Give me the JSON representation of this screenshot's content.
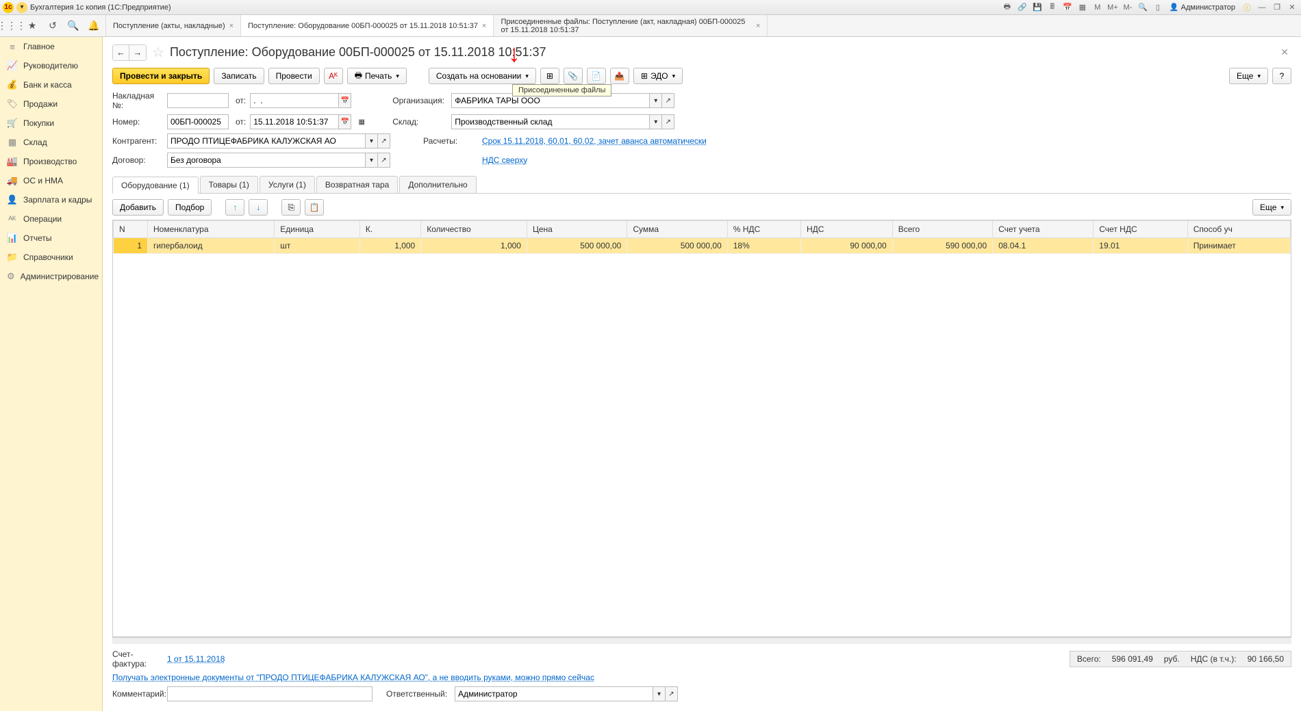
{
  "titlebar": {
    "app_title": "Бухгалтерия 1с копия  (1С:Предприятие)",
    "user": "Администратор",
    "m_labels": [
      "M",
      "M+",
      "M-"
    ]
  },
  "doc_tabs": [
    {
      "label": "Поступление (акты, накладные)",
      "active": false
    },
    {
      "label": "Поступление: Оборудование 00БП-000025 от 15.11.2018 10:51:37",
      "active": true
    },
    {
      "label": "Присоединенные файлы: Поступление (акт, накладная) 00БП-000025 от 15.11.2018 10:51:37",
      "active": false
    }
  ],
  "sidebar": [
    {
      "icon": "≡",
      "label": "Главное"
    },
    {
      "icon": "📈",
      "label": "Руководителю"
    },
    {
      "icon": "💰",
      "label": "Банк и касса"
    },
    {
      "icon": "🏷",
      "label": "Продажи"
    },
    {
      "icon": "🛒",
      "label": "Покупки"
    },
    {
      "icon": "▦",
      "label": "Склад"
    },
    {
      "icon": "🏭",
      "label": "Производство"
    },
    {
      "icon": "🚚",
      "label": "ОС и НМА"
    },
    {
      "icon": "👤",
      "label": "Зарплата и кадры"
    },
    {
      "icon": "ᴬᴷ",
      "label": "Операции"
    },
    {
      "icon": "📊",
      "label": "Отчеты"
    },
    {
      "icon": "📁",
      "label": "Справочники"
    },
    {
      "icon": "⚙",
      "label": "Администрирование"
    }
  ],
  "doc": {
    "title": "Поступление: Оборудование 00БП-000025 от 15.11.2018 10:51:37"
  },
  "toolbar": {
    "post_close": "Провести и закрыть",
    "save": "Записать",
    "post": "Провести",
    "print": "Печать",
    "create_based": "Создать на основании",
    "edo": "ЭДО",
    "more": "Еще",
    "help": "?",
    "tooltip": "Присоединенные файлы"
  },
  "form": {
    "invoice_no_lbl": "Накладная  №:",
    "invoice_no": "",
    "from_lbl": "от:",
    "invoice_date": ".  .",
    "number_lbl": "Номер:",
    "number": "00БП-000025",
    "date": "15.11.2018 10:51:37",
    "org_lbl": "Организация:",
    "org": "ФАБРИКА ТАРЫ ООО",
    "warehouse_lbl": "Склад:",
    "warehouse": "Производственный склад",
    "counterparty_lbl": "Контрагент:",
    "counterparty": "ПРОДО ПТИЦЕФАБРИКА КАЛУЖСКАЯ АО",
    "calc_lbl": "Расчеты:",
    "calc_link": "Срок 15.11.2018, 60.01, 60.02, зачет аванса автоматически",
    "contract_lbl": "Договор:",
    "contract": "Без договора",
    "vat_link": "НДС сверху"
  },
  "inner_tabs": [
    {
      "label": "Оборудование (1)",
      "active": true
    },
    {
      "label": "Товары (1)",
      "active": false
    },
    {
      "label": "Услуги (1)",
      "active": false
    },
    {
      "label": "Возвратная тара",
      "active": false
    },
    {
      "label": "Дополнительно",
      "active": false
    }
  ],
  "tbl_toolbar": {
    "add": "Добавить",
    "select": "Подбор",
    "more": "Еще"
  },
  "table": {
    "cols": [
      "N",
      "Номенклатура",
      "Единица",
      "К.",
      "Количество",
      "Цена",
      "Сумма",
      "% НДС",
      "НДС",
      "Всего",
      "Счет учета",
      "Счет НДС",
      "Способ уч"
    ],
    "rows": [
      {
        "n": "1",
        "nom": "гипербалоид",
        "unit": "шт",
        "k": "1,000",
        "qty": "1,000",
        "price": "500 000,00",
        "sum": "500 000,00",
        "vat_pct": "18%",
        "vat": "90 000,00",
        "total": "590 000,00",
        "acc": "08.04.1",
        "vat_acc": "19.01",
        "method": "Принимает"
      }
    ]
  },
  "footer": {
    "invoice_lbl": "Счет-фактура:",
    "invoice_link": "1 от 15.11.2018",
    "edo_link": "Получать электронные документы от \"ПРОДО ПТИЦЕФАБРИКА КАЛУЖСКАЯ АО\", а не вводить руками, можно прямо сейчас",
    "comment_lbl": "Комментарий:",
    "comment": "",
    "responsible_lbl": "Ответственный:",
    "responsible": "Администратор",
    "totals": {
      "total_lbl": "Всего:",
      "total": "596 091,49",
      "currency": "руб.",
      "vat_lbl": "НДС (в т.ч.):",
      "vat": "90 166,50"
    }
  }
}
